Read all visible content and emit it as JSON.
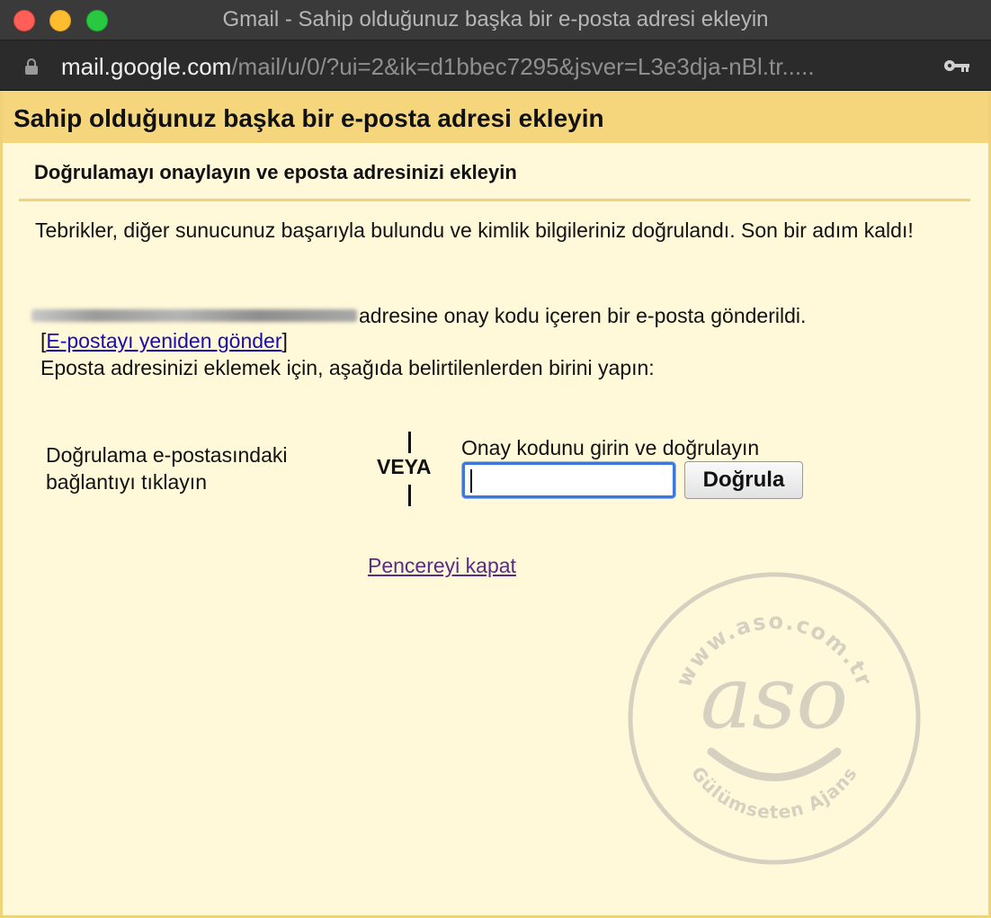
{
  "window": {
    "title": "Gmail - Sahip olduğunuz başka bir e-posta adresi ekleyin"
  },
  "address_bar": {
    "host": "mail.google.com",
    "path": "/mail/u/0/?ui=2&ik=d1bbec7295&jsver=L3e3dja-nBl.tr....."
  },
  "dialog": {
    "title": "Sahip olduğunuz başka bir e-posta adresi ekleyin",
    "subtitle": "Doğrulamayı onaylayın ve eposta adresinizi ekleyin",
    "congrats": "Tebrikler, diğer sunucunuz başarıyla bulundu ve kimlik bilgileriniz doğrulandı. Son bir adım kaldı!",
    "sent_message": "adresine onay kodu içeren bir e-posta gönderildi.",
    "resend_open": "[",
    "resend_link": "E-postayı yeniden gönder",
    "resend_close": "]",
    "instruction": "Eposta adresinizi eklemek için, aşağıda belirtilenlerden birini yapın:",
    "option_link_text": "Doğrulama e-postasındaki bağlantıyı tıklayın",
    "or_label": "VEYA",
    "code_label": "Onay kodunu girin ve doğrulayın",
    "code_value": "",
    "verify_button": "Doğrula",
    "close_link": "Pencereyi kapat"
  },
  "watermark": {
    "top_text": "www.aso.com.tr",
    "logo_text": "aso",
    "bottom_text": "Gülümseten Ajans"
  },
  "colors": {
    "header_band": "#f5d67c",
    "page_background": "#fff8d9",
    "link": "#1a0dab",
    "visited_link": "#5b2a86",
    "input_focus": "#3b78d8"
  }
}
